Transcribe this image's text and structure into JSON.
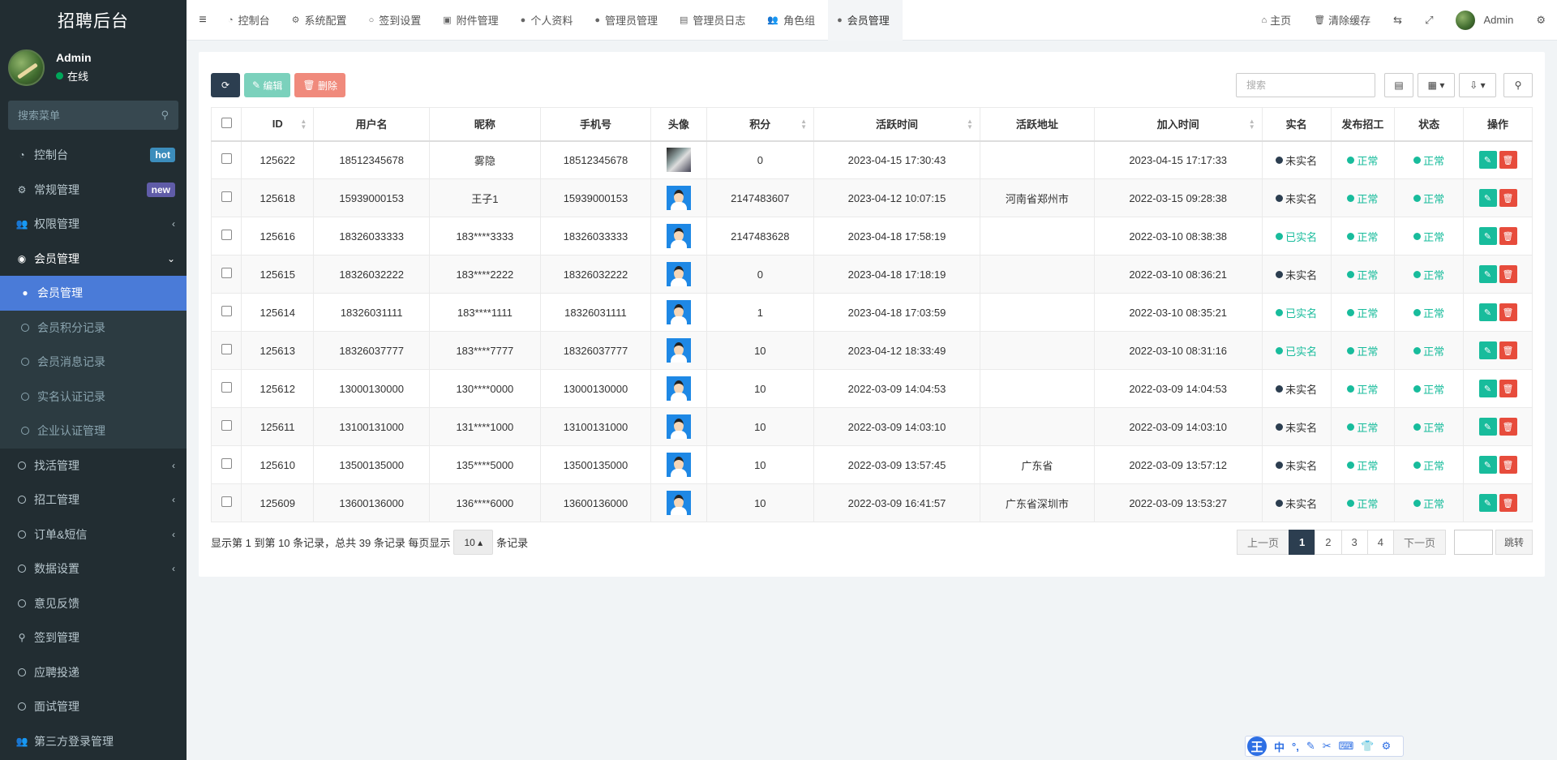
{
  "app": {
    "title": "招聘后台"
  },
  "user": {
    "name": "Admin",
    "status": "在线"
  },
  "sidebar": {
    "search_placeholder": "搜索菜单",
    "items": [
      {
        "label": "控制台",
        "icon": "dashboard-icon",
        "badge": "hot"
      },
      {
        "label": "常规管理",
        "icon": "cogs-icon",
        "badge": "new"
      },
      {
        "label": "权限管理",
        "icon": "group-icon",
        "arrow": "‹"
      },
      {
        "label": "会员管理",
        "icon": "user-circle-icon",
        "arrow": "⌄"
      },
      {
        "label": "会员管理",
        "icon": "user-icon"
      },
      {
        "label": "会员积分记录",
        "icon": "circle-o-icon"
      },
      {
        "label": "会员消息记录",
        "icon": "circle-o-icon"
      },
      {
        "label": "实名认证记录",
        "icon": "circle-o-icon"
      },
      {
        "label": "企业认证管理",
        "icon": "circle-o-icon"
      },
      {
        "label": "找活管理",
        "icon": "circle-o-icon",
        "arrow": "‹"
      },
      {
        "label": "招工管理",
        "icon": "circle-o-icon",
        "arrow": "‹"
      },
      {
        "label": "订单&短信",
        "icon": "circle-o-icon",
        "arrow": "‹"
      },
      {
        "label": "数据设置",
        "icon": "circle-o-icon",
        "arrow": "‹"
      },
      {
        "label": "意见反馈",
        "icon": "circle-o-icon"
      },
      {
        "label": "签到管理",
        "icon": "map-marker-icon"
      },
      {
        "label": "应聘投递",
        "icon": "circle-o-icon"
      },
      {
        "label": "面试管理",
        "icon": "circle-o-icon"
      },
      {
        "label": "第三方登录管理",
        "icon": "group-icon"
      }
    ]
  },
  "tabs": [
    {
      "label": "控制台",
      "icon": "dashboard-icon"
    },
    {
      "label": "系统配置",
      "icon": "cog-icon"
    },
    {
      "label": "签到设置",
      "icon": "circle-o-icon"
    },
    {
      "label": "附件管理",
      "icon": "file-image-icon"
    },
    {
      "label": "个人资料",
      "icon": "user-icon"
    },
    {
      "label": "管理员管理",
      "icon": "user-icon"
    },
    {
      "label": "管理员日志",
      "icon": "list-alt-icon"
    },
    {
      "label": "角色组",
      "icon": "group-icon"
    },
    {
      "label": "会员管理",
      "icon": "user-icon"
    }
  ],
  "topright": {
    "home": "主页",
    "clear_cache": "清除缓存",
    "admin": "Admin"
  },
  "toolbar": {
    "edit": "编辑",
    "delete": "删除",
    "search_placeholder": "搜索"
  },
  "table": {
    "headers": [
      "ID",
      "用户名",
      "昵称",
      "手机号",
      "头像",
      "积分",
      "活跃时间",
      "活跃地址",
      "加入时间",
      "实名",
      "发布招工",
      "状态",
      "操作"
    ],
    "rows": [
      {
        "id": "125622",
        "username": "18512345678",
        "nickname": "雾隐",
        "mobile": "18512345678",
        "avatar": "photo",
        "score": "0",
        "active_time": "2023-04-15 17:30:43",
        "active_addr": "",
        "join_time": "2023-04-15 17:17:33",
        "realname": "未实名",
        "publish": "正常",
        "status": "正常"
      },
      {
        "id": "125618",
        "username": "15939000153",
        "nickname": "王子1",
        "mobile": "15939000153",
        "avatar": "default",
        "score": "2147483607",
        "active_time": "2023-04-12 10:07:15",
        "active_addr": "河南省郑州市",
        "join_time": "2022-03-15 09:28:38",
        "realname": "未实名",
        "publish": "正常",
        "status": "正常"
      },
      {
        "id": "125616",
        "username": "18326033333",
        "nickname": "183****3333",
        "mobile": "18326033333",
        "avatar": "default",
        "score": "2147483628",
        "active_time": "2023-04-18 17:58:19",
        "active_addr": "",
        "join_time": "2022-03-10 08:38:38",
        "realname": "已实名",
        "publish": "正常",
        "status": "正常"
      },
      {
        "id": "125615",
        "username": "18326032222",
        "nickname": "183****2222",
        "mobile": "18326032222",
        "avatar": "default",
        "score": "0",
        "active_time": "2023-04-18 17:18:19",
        "active_addr": "",
        "join_time": "2022-03-10 08:36:21",
        "realname": "未实名",
        "publish": "正常",
        "status": "正常"
      },
      {
        "id": "125614",
        "username": "18326031111",
        "nickname": "183****1111",
        "mobile": "18326031111",
        "avatar": "default",
        "score": "1",
        "active_time": "2023-04-18 17:03:59",
        "active_addr": "",
        "join_time": "2022-03-10 08:35:21",
        "realname": "已实名",
        "publish": "正常",
        "status": "正常"
      },
      {
        "id": "125613",
        "username": "18326037777",
        "nickname": "183****7777",
        "mobile": "18326037777",
        "avatar": "default",
        "score": "10",
        "active_time": "2023-04-12 18:33:49",
        "active_addr": "",
        "join_time": "2022-03-10 08:31:16",
        "realname": "已实名",
        "publish": "正常",
        "status": "正常"
      },
      {
        "id": "125612",
        "username": "13000130000",
        "nickname": "130****0000",
        "mobile": "13000130000",
        "avatar": "default",
        "score": "10",
        "active_time": "2022-03-09 14:04:53",
        "active_addr": "",
        "join_time": "2022-03-09 14:04:53",
        "realname": "未实名",
        "publish": "正常",
        "status": "正常"
      },
      {
        "id": "125611",
        "username": "13100131000",
        "nickname": "131****1000",
        "mobile": "13100131000",
        "avatar": "default",
        "score": "10",
        "active_time": "2022-03-09 14:03:10",
        "active_addr": "",
        "join_time": "2022-03-09 14:03:10",
        "realname": "未实名",
        "publish": "正常",
        "status": "正常"
      },
      {
        "id": "125610",
        "username": "13500135000",
        "nickname": "135****5000",
        "mobile": "13500135000",
        "avatar": "default",
        "score": "10",
        "active_time": "2022-03-09 13:57:45",
        "active_addr": "广东省",
        "join_time": "2022-03-09 13:57:12",
        "realname": "未实名",
        "publish": "正常",
        "status": "正常"
      },
      {
        "id": "125609",
        "username": "13600136000",
        "nickname": "136****6000",
        "mobile": "13600136000",
        "avatar": "default",
        "score": "10",
        "active_time": "2022-03-09 16:41:57",
        "active_addr": "广东省深圳市",
        "join_time": "2022-03-09 13:53:27",
        "realname": "未实名",
        "publish": "正常",
        "status": "正常"
      }
    ]
  },
  "footer": {
    "info": "显示第 1 到第 10 条记录，总共 39 条记录 每页显示",
    "page_size": "10",
    "suffix": "条记录"
  },
  "pager": {
    "prev": "上一页",
    "pages": [
      "1",
      "2",
      "3",
      "4"
    ],
    "current": "1",
    "next": "下一页",
    "jump": "跳转"
  },
  "ime": {
    "logo": "王",
    "mode": "中"
  },
  "colors": {
    "sidebar_bg": "#222d32",
    "active_blue": "#4a7bd8",
    "success": "#18bc9c",
    "danger": "#e74c3c",
    "dark": "#2c3e50"
  }
}
